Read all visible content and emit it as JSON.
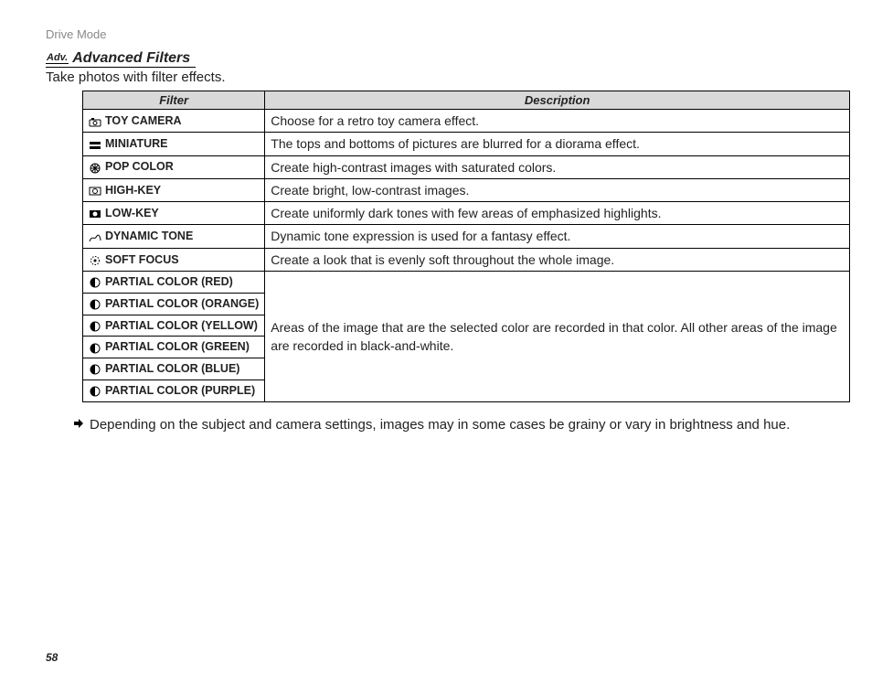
{
  "breadcrumb": "Drive Mode",
  "section_badge": "Adv.",
  "section_title": "Advanced Filters",
  "intro": "Take photos with filter effects.",
  "table": {
    "header_filter": "Filter",
    "header_desc": "Description",
    "rows": [
      {
        "icon": "toy",
        "name": "TOY CAMERA",
        "desc": "Choose for a retro toy camera effect."
      },
      {
        "icon": "mini",
        "name": "MINIATURE",
        "desc": "The tops and bottoms of pictures are blurred for a diorama effect."
      },
      {
        "icon": "pop",
        "name": "POP COLOR",
        "desc": "Create high-contrast images with saturated colors."
      },
      {
        "icon": "high",
        "name": "HIGH-KEY",
        "desc": "Create bright, low-contrast images."
      },
      {
        "icon": "low",
        "name": "LOW-KEY",
        "desc": "Create uniformly dark tones with few areas of emphasized highlights."
      },
      {
        "icon": "dyn",
        "name": "DYNAMIC TONE",
        "desc": "Dynamic tone expression is used for a fantasy effect."
      },
      {
        "icon": "soft",
        "name": "SOFT FOCUS",
        "desc": "Create a look that is evenly soft throughout the whole image."
      },
      {
        "icon": "partial",
        "name": "PARTIAL COLOR (RED)"
      },
      {
        "icon": "partial",
        "name": "PARTIAL COLOR (ORANGE)"
      },
      {
        "icon": "partial",
        "name": "PARTIAL COLOR (YELLOW)"
      },
      {
        "icon": "partial",
        "name": "PARTIAL COLOR (GREEN)"
      },
      {
        "icon": "partial",
        "name": "PARTIAL COLOR (BLUE)"
      },
      {
        "icon": "partial",
        "name": "PARTIAL COLOR (PURPLE)"
      }
    ],
    "partial_desc": "Areas of the image that are the selected color are recorded in that color.  All other areas of the image are recorded in black-and-white."
  },
  "note": "Depending on the subject and camera settings, images may in some cases be grainy or vary in brightness and hue.",
  "page_number": "58"
}
